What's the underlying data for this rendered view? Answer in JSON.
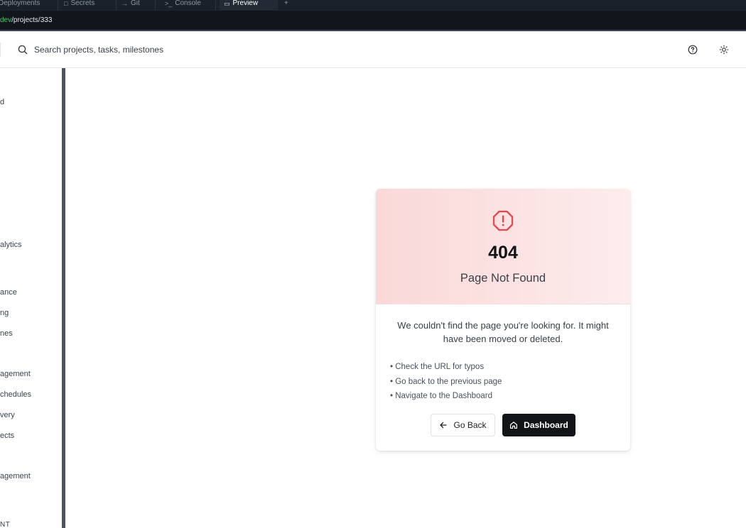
{
  "ide_tabs": [
    {
      "label": "Deployments",
      "icon": "rocket-icon"
    },
    {
      "label": "Secrets",
      "icon": "lock-icon"
    },
    {
      "label": "Git",
      "icon": "git-branch-icon"
    },
    {
      "label": "Console",
      "icon": "terminal-icon"
    },
    {
      "label": "Preview",
      "icon": "monitor-icon",
      "active": true
    },
    {
      "label": "+",
      "icon": "plus-icon"
    }
  ],
  "url_bar": {
    "host": "dev",
    "path": "/projects/333"
  },
  "header": {
    "search_placeholder": "Search projects, tasks, milestones",
    "help_icon": "help-circle-icon",
    "theme_icon": "sun-icon"
  },
  "sidebar": {
    "items": [
      {
        "label": "d"
      },
      {
        "label": "alytics"
      },
      {
        "label": "ance"
      },
      {
        "label": "ng"
      },
      {
        "label": "nes"
      },
      {
        "label": "agement"
      },
      {
        "label": "chedules"
      },
      {
        "label": "very"
      },
      {
        "label": "ects"
      },
      {
        "label": "agement"
      },
      {
        "label": "NT"
      }
    ]
  },
  "error_card": {
    "icon": "octagon-alert-icon",
    "code": "404",
    "title": "Page Not Found",
    "description": "We couldn't find the page you're looking for. It might have been moved or deleted.",
    "tips": [
      "• Check the URL for typos",
      "• Go back to the previous page",
      "• Navigate to the Dashboard"
    ],
    "back_button": "Go Back",
    "dashboard_button": "Dashboard"
  },
  "colors": {
    "card_gradient_start": "#fad8d8",
    "card_gradient_end": "#fdecec",
    "alert_red": "#e5484d",
    "url_host_green": "#4ec26b",
    "primary_button": "#121417"
  }
}
